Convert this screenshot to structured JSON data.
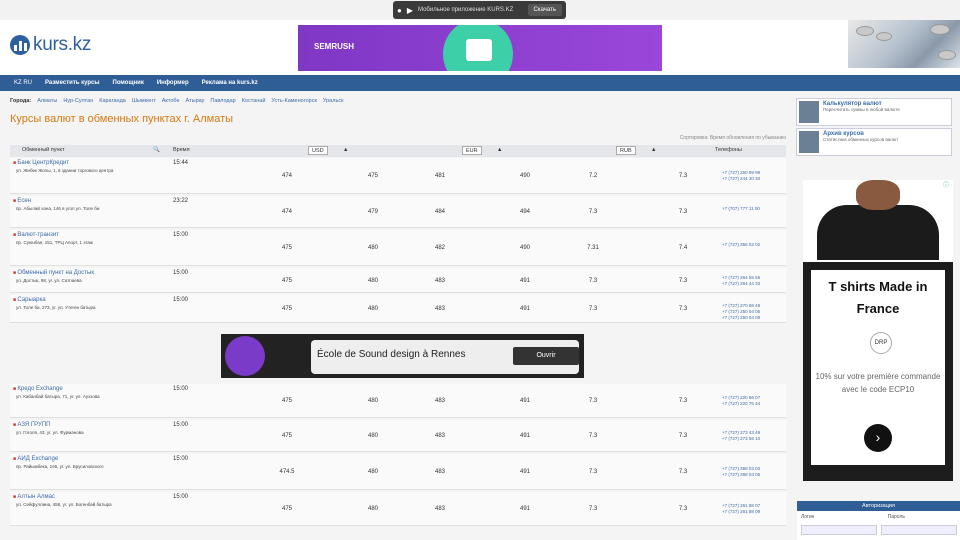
{
  "topbar": {
    "app_text": "Мобильное приложение KURS.KZ",
    "download": "Скачать"
  },
  "logo": {
    "text": "kurs.kz"
  },
  "banner": {
    "brand": "SEMRUSH"
  },
  "nav": {
    "flag": "KZ RU",
    "items": [
      "Разместить курсы",
      "Помощник",
      "Информер",
      "Реклама на kurs.kz"
    ]
  },
  "cities": {
    "label": "Города:",
    "items": [
      "Алматы",
      "Нур-Султан",
      "Караганда",
      "Шымкент",
      "Актобе",
      "Атырау",
      "Павлодар",
      "Костанай",
      "Усть-Каменогорск",
      "Уральск"
    ]
  },
  "page_title": "Курсы валют в обменных пунктах г. Алматы",
  "sort_hint": "Сортировка: Время обновления по убыванию",
  "table": {
    "head": {
      "point": "Обменный пункт",
      "time": "Время",
      "c1": "USD",
      "c2": "EUR",
      "c3": "RUB",
      "phones": "Телефоны"
    },
    "rows": [
      {
        "name": "Банк ЦентрКредит",
        "address": "ул. Жибек Жолы, 1, в здании торгового центра",
        "time": "15:44",
        "vals": [
          "474",
          "475",
          "481",
          "490",
          "7.2",
          "7.3"
        ],
        "phones": [
          "+7 (727) 250 99 99",
          "+7 (727) 244 30 30"
        ]
      },
      {
        "name": "Есен",
        "address": "пр. Абылай хана, 146 в угол ул. Толе би",
        "time": "23:22",
        "vals": [
          "474",
          "479",
          "484",
          "494",
          "7.3",
          "7.3"
        ],
        "phones": [
          "+7 (707) 777 11 00"
        ]
      },
      {
        "name": "Валют-транзит",
        "address": "пр. Суюнбая, 151, ТРЦ Апорт, 1 этаж",
        "time": "15:00",
        "vals": [
          "475",
          "480",
          "482",
          "490",
          "7.31",
          "7.4"
        ],
        "phones": [
          "+7 (727) 356 02 02"
        ]
      },
      {
        "name": "Обменный пункт на Достык",
        "address": "ул. Достык, 98, уг. ул. Сатпаева",
        "time": "15:00",
        "vals": [
          "475",
          "480",
          "483",
          "491",
          "7.3",
          "7.3"
        ],
        "phones": [
          "+7 (727) 264 55 55",
          "+7 (727) 264 44 33"
        ]
      },
      {
        "name": "Сарыарка",
        "address": "ул. Толе би, 273, уг. ул. Утеген батыра",
        "time": "15:00",
        "vals": [
          "475",
          "480",
          "483",
          "491",
          "7.3",
          "7.3"
        ],
        "phones": [
          "+7 (727) 270 68 48",
          "+7 (727) 250 04 05",
          "+7 (727) 250 04 09"
        ]
      },
      {
        "name": "Кредо Exchange",
        "address": "ул. Кабанбай батыра, 71, уг. ул. Ауэзова",
        "time": "15:00",
        "vals": [
          "475",
          "480",
          "483",
          "491",
          "7.3",
          "7.3"
        ],
        "phones": [
          "+7 (727) 220 66 07",
          "+7 (727) 220 76 44"
        ]
      },
      {
        "name": "АЗЯ ГРУПП",
        "address": "ул. Гоголя, 43, уг. ул. Фурманова",
        "time": "15:00",
        "vals": [
          "475",
          "480",
          "483",
          "491",
          "7.3",
          "7.3"
        ],
        "phones": [
          "+7 (727) 273 43 49",
          "+7 (727) 273 58 10"
        ]
      },
      {
        "name": "АИД Exchange",
        "address": "пр. Райымбека, 165, уг. ул. Брусиловского",
        "time": "15:00",
        "vals": [
          "474.5",
          "480",
          "483",
          "491",
          "7.3",
          "7.3"
        ],
        "phones": [
          "+7 (727) 398 03 03",
          "+7 (727) 398 03 05"
        ]
      },
      {
        "name": "Алтын Алмас",
        "address": "ул. Сейфуллина, 458, уг. ул. Богенбай батыра",
        "time": "15:00",
        "vals": [
          "475",
          "480",
          "483",
          "491",
          "7.3",
          "7.3"
        ],
        "phones": [
          "+7 (727) 261 88 07",
          "+7 (727) 261 88 09"
        ]
      }
    ]
  },
  "ad_inline": {
    "text": "École de Sound design à Rennes",
    "button": "Ouvrir"
  },
  "sidebar": {
    "items": [
      {
        "title": "Калькулятор валют",
        "desc": "Пересчитать суммы в любой валюте"
      },
      {
        "title": "Архив курсов",
        "desc": "Статистика обменных курсов валют"
      }
    ]
  },
  "ad_side": {
    "title": "T shirts Made in France",
    "logo": "DRP",
    "desc": "10% sur votre première commande avec le code ECP10",
    "go": "›"
  },
  "auth": {
    "header": "Авторизация",
    "login": "Логин",
    "password": "Пароль"
  }
}
